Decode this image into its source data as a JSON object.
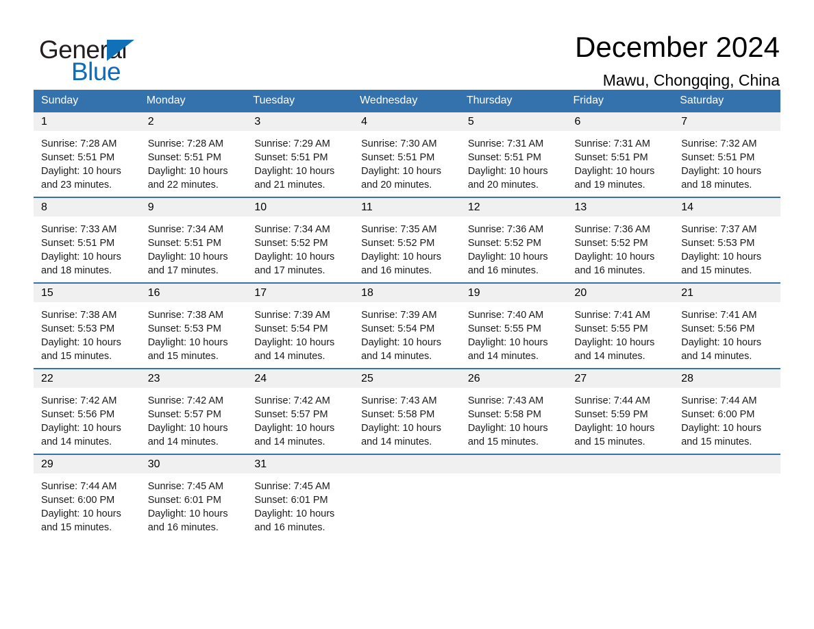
{
  "brand": {
    "name_part1": "General",
    "name_part2": "Blue",
    "triangle_color": "#1071b8",
    "blue": "#0d6cb9"
  },
  "header": {
    "title": "December 2024",
    "subtitle": "Mawu, Chongqing, China"
  },
  "theme": {
    "header_blue": "#3472ad",
    "daynum_band": "#f0f0f0",
    "separator": "#3472ad"
  },
  "weekday_headers": [
    "Sunday",
    "Monday",
    "Tuesday",
    "Wednesday",
    "Thursday",
    "Friday",
    "Saturday"
  ],
  "weeks": [
    [
      {
        "day": "1",
        "sunrise": "Sunrise: 7:28 AM",
        "sunset": "Sunset: 5:51 PM",
        "daylight_line1": "Daylight: 10 hours",
        "daylight_line2": "and 23 minutes."
      },
      {
        "day": "2",
        "sunrise": "Sunrise: 7:28 AM",
        "sunset": "Sunset: 5:51 PM",
        "daylight_line1": "Daylight: 10 hours",
        "daylight_line2": "and 22 minutes."
      },
      {
        "day": "3",
        "sunrise": "Sunrise: 7:29 AM",
        "sunset": "Sunset: 5:51 PM",
        "daylight_line1": "Daylight: 10 hours",
        "daylight_line2": "and 21 minutes."
      },
      {
        "day": "4",
        "sunrise": "Sunrise: 7:30 AM",
        "sunset": "Sunset: 5:51 PM",
        "daylight_line1": "Daylight: 10 hours",
        "daylight_line2": "and 20 minutes."
      },
      {
        "day": "5",
        "sunrise": "Sunrise: 7:31 AM",
        "sunset": "Sunset: 5:51 PM",
        "daylight_line1": "Daylight: 10 hours",
        "daylight_line2": "and 20 minutes."
      },
      {
        "day": "6",
        "sunrise": "Sunrise: 7:31 AM",
        "sunset": "Sunset: 5:51 PM",
        "daylight_line1": "Daylight: 10 hours",
        "daylight_line2": "and 19 minutes."
      },
      {
        "day": "7",
        "sunrise": "Sunrise: 7:32 AM",
        "sunset": "Sunset: 5:51 PM",
        "daylight_line1": "Daylight: 10 hours",
        "daylight_line2": "and 18 minutes."
      }
    ],
    [
      {
        "day": "8",
        "sunrise": "Sunrise: 7:33 AM",
        "sunset": "Sunset: 5:51 PM",
        "daylight_line1": "Daylight: 10 hours",
        "daylight_line2": "and 18 minutes."
      },
      {
        "day": "9",
        "sunrise": "Sunrise: 7:34 AM",
        "sunset": "Sunset: 5:51 PM",
        "daylight_line1": "Daylight: 10 hours",
        "daylight_line2": "and 17 minutes."
      },
      {
        "day": "10",
        "sunrise": "Sunrise: 7:34 AM",
        "sunset": "Sunset: 5:52 PM",
        "daylight_line1": "Daylight: 10 hours",
        "daylight_line2": "and 17 minutes."
      },
      {
        "day": "11",
        "sunrise": "Sunrise: 7:35 AM",
        "sunset": "Sunset: 5:52 PM",
        "daylight_line1": "Daylight: 10 hours",
        "daylight_line2": "and 16 minutes."
      },
      {
        "day": "12",
        "sunrise": "Sunrise: 7:36 AM",
        "sunset": "Sunset: 5:52 PM",
        "daylight_line1": "Daylight: 10 hours",
        "daylight_line2": "and 16 minutes."
      },
      {
        "day": "13",
        "sunrise": "Sunrise: 7:36 AM",
        "sunset": "Sunset: 5:52 PM",
        "daylight_line1": "Daylight: 10 hours",
        "daylight_line2": "and 16 minutes."
      },
      {
        "day": "14",
        "sunrise": "Sunrise: 7:37 AM",
        "sunset": "Sunset: 5:53 PM",
        "daylight_line1": "Daylight: 10 hours",
        "daylight_line2": "and 15 minutes."
      }
    ],
    [
      {
        "day": "15",
        "sunrise": "Sunrise: 7:38 AM",
        "sunset": "Sunset: 5:53 PM",
        "daylight_line1": "Daylight: 10 hours",
        "daylight_line2": "and 15 minutes."
      },
      {
        "day": "16",
        "sunrise": "Sunrise: 7:38 AM",
        "sunset": "Sunset: 5:53 PM",
        "daylight_line1": "Daylight: 10 hours",
        "daylight_line2": "and 15 minutes."
      },
      {
        "day": "17",
        "sunrise": "Sunrise: 7:39 AM",
        "sunset": "Sunset: 5:54 PM",
        "daylight_line1": "Daylight: 10 hours",
        "daylight_line2": "and 14 minutes."
      },
      {
        "day": "18",
        "sunrise": "Sunrise: 7:39 AM",
        "sunset": "Sunset: 5:54 PM",
        "daylight_line1": "Daylight: 10 hours",
        "daylight_line2": "and 14 minutes."
      },
      {
        "day": "19",
        "sunrise": "Sunrise: 7:40 AM",
        "sunset": "Sunset: 5:55 PM",
        "daylight_line1": "Daylight: 10 hours",
        "daylight_line2": "and 14 minutes."
      },
      {
        "day": "20",
        "sunrise": "Sunrise: 7:41 AM",
        "sunset": "Sunset: 5:55 PM",
        "daylight_line1": "Daylight: 10 hours",
        "daylight_line2": "and 14 minutes."
      },
      {
        "day": "21",
        "sunrise": "Sunrise: 7:41 AM",
        "sunset": "Sunset: 5:56 PM",
        "daylight_line1": "Daylight: 10 hours",
        "daylight_line2": "and 14 minutes."
      }
    ],
    [
      {
        "day": "22",
        "sunrise": "Sunrise: 7:42 AM",
        "sunset": "Sunset: 5:56 PM",
        "daylight_line1": "Daylight: 10 hours",
        "daylight_line2": "and 14 minutes."
      },
      {
        "day": "23",
        "sunrise": "Sunrise: 7:42 AM",
        "sunset": "Sunset: 5:57 PM",
        "daylight_line1": "Daylight: 10 hours",
        "daylight_line2": "and 14 minutes."
      },
      {
        "day": "24",
        "sunrise": "Sunrise: 7:42 AM",
        "sunset": "Sunset: 5:57 PM",
        "daylight_line1": "Daylight: 10 hours",
        "daylight_line2": "and 14 minutes."
      },
      {
        "day": "25",
        "sunrise": "Sunrise: 7:43 AM",
        "sunset": "Sunset: 5:58 PM",
        "daylight_line1": "Daylight: 10 hours",
        "daylight_line2": "and 14 minutes."
      },
      {
        "day": "26",
        "sunrise": "Sunrise: 7:43 AM",
        "sunset": "Sunset: 5:58 PM",
        "daylight_line1": "Daylight: 10 hours",
        "daylight_line2": "and 15 minutes."
      },
      {
        "day": "27",
        "sunrise": "Sunrise: 7:44 AM",
        "sunset": "Sunset: 5:59 PM",
        "daylight_line1": "Daylight: 10 hours",
        "daylight_line2": "and 15 minutes."
      },
      {
        "day": "28",
        "sunrise": "Sunrise: 7:44 AM",
        "sunset": "Sunset: 6:00 PM",
        "daylight_line1": "Daylight: 10 hours",
        "daylight_line2": "and 15 minutes."
      }
    ],
    [
      {
        "day": "29",
        "sunrise": "Sunrise: 7:44 AM",
        "sunset": "Sunset: 6:00 PM",
        "daylight_line1": "Daylight: 10 hours",
        "daylight_line2": "and 15 minutes."
      },
      {
        "day": "30",
        "sunrise": "Sunrise: 7:45 AM",
        "sunset": "Sunset: 6:01 PM",
        "daylight_line1": "Daylight: 10 hours",
        "daylight_line2": "and 16 minutes."
      },
      {
        "day": "31",
        "sunrise": "Sunrise: 7:45 AM",
        "sunset": "Sunset: 6:01 PM",
        "daylight_line1": "Daylight: 10 hours",
        "daylight_line2": "and 16 minutes."
      },
      {
        "day": "",
        "sunrise": "",
        "sunset": "",
        "daylight_line1": "",
        "daylight_line2": ""
      },
      {
        "day": "",
        "sunrise": "",
        "sunset": "",
        "daylight_line1": "",
        "daylight_line2": ""
      },
      {
        "day": "",
        "sunrise": "",
        "sunset": "",
        "daylight_line1": "",
        "daylight_line2": ""
      },
      {
        "day": "",
        "sunrise": "",
        "sunset": "",
        "daylight_line1": "",
        "daylight_line2": ""
      }
    ]
  ]
}
